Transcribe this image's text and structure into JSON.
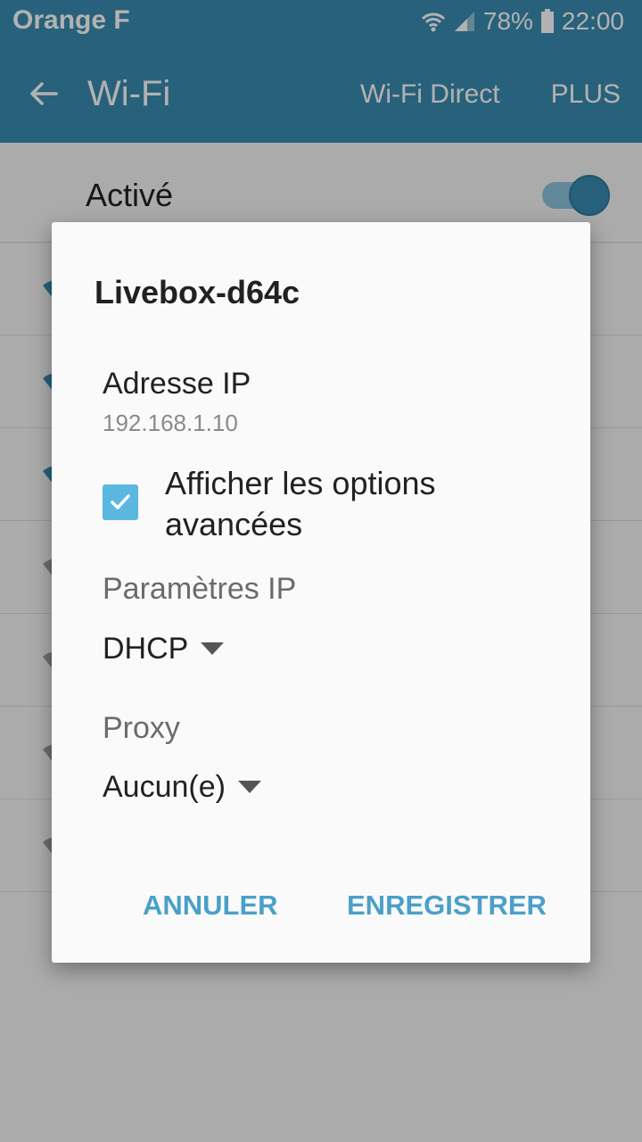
{
  "status_bar": {
    "carrier": "Orange F",
    "battery": "78%",
    "time": "22:00",
    "icons": [
      "wifi-icon",
      "signal-icon",
      "battery-icon"
    ]
  },
  "app_bar": {
    "title": "Wi-Fi",
    "wifi_direct": "Wi-Fi Direct",
    "more": "PLUS"
  },
  "wifi_toggle": {
    "label": "Activé",
    "state": "on"
  },
  "dialog": {
    "title": "Livebox-d64c",
    "ip_label": "Adresse IP",
    "ip_value": "192.168.1.10",
    "advanced_checkbox": {
      "label": "Afficher les options avancées",
      "checked": true
    },
    "ip_settings_label": "Paramètres IP",
    "ip_settings_value": "DHCP",
    "proxy_label": "Proxy",
    "proxy_value": "Aucun(e)",
    "cancel": "ANNULER",
    "save": "ENREGISTRER"
  },
  "colors": {
    "accent": "#3a8bb0",
    "button_text": "#4aa0c8",
    "checkbox": "#5bb7df"
  }
}
